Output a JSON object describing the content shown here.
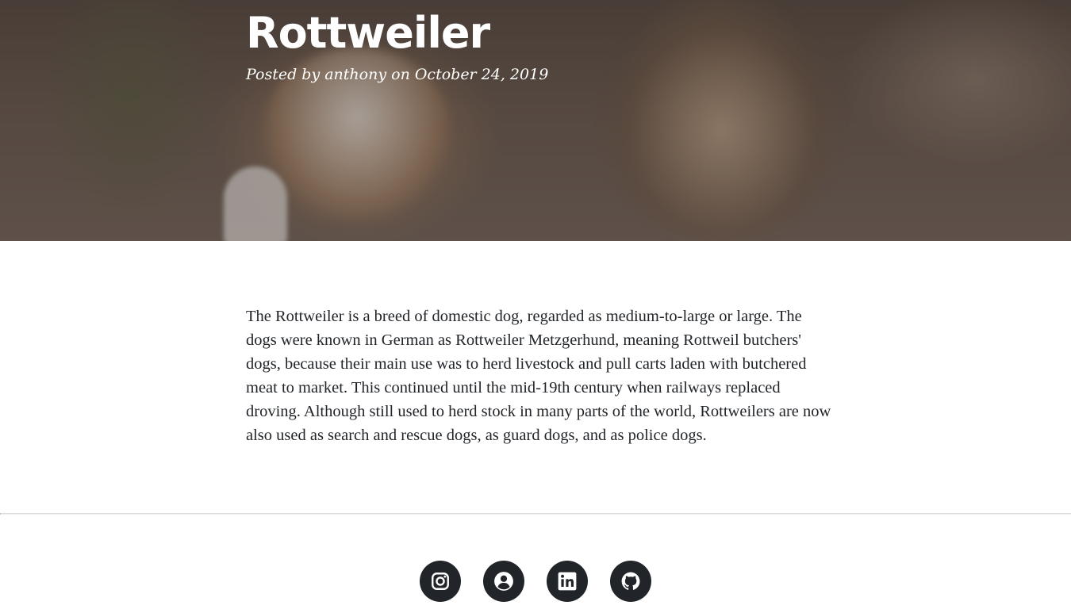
{
  "post": {
    "title": "Rottweiler",
    "meta_prefix": "Posted by ",
    "author": "anthony",
    "meta_mid": " on ",
    "date": "October 24, 2019",
    "body": "The Rottweiler is a breed of domestic dog, regarded as medium-to-large or large. The dogs were known in German as Rottweiler Metzgerhund, meaning Rottweil butchers' dogs, because their main use was to herd livestock and pull carts laden with butchered meat to market. This continued until the mid-19th century when railways replaced droving. Although still used to herd stock in many parts of the world, Rottweilers are now also used as search and rescue dogs, as guard dogs, and as police dogs."
  },
  "social": [
    {
      "icon": "instagram-icon"
    },
    {
      "icon": "user-circle-icon"
    },
    {
      "icon": "linkedin-icon"
    },
    {
      "icon": "github-icon"
    }
  ],
  "colors": {
    "text": "#212529",
    "social_bg": "#212529",
    "divider": "#dedede"
  }
}
